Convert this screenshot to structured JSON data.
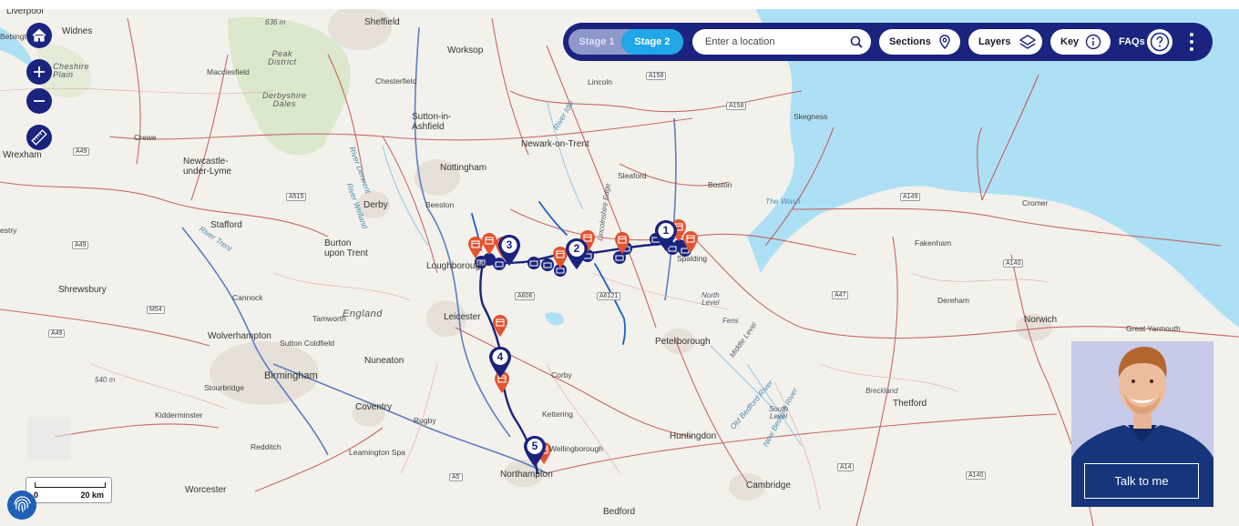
{
  "toolbar": {
    "stage1_label": "Stage 1",
    "stage2_label": "Stage 2",
    "active_stage": "Stage 2",
    "search_placeholder": "Enter a location",
    "sections_label": "Sections",
    "layers_label": "Layers",
    "key_label": "Key",
    "faqs_label": "FAQs",
    "colors": {
      "bar": "#1a237e",
      "active_stage": "#21a6e8"
    }
  },
  "controls": {
    "icons": [
      "home-icon",
      "zoom-in-icon",
      "zoom-out-icon",
      "ruler-icon",
      "fingerprint-icon"
    ]
  },
  "scale": {
    "zero": "0",
    "distance": "20 km"
  },
  "assistant": {
    "button_label": "Talk to me"
  },
  "route": {
    "color": "#1a237e",
    "markers": [
      "1",
      "2",
      "3",
      "4",
      "5"
    ],
    "event_marker_color": "#e4522f",
    "camera_marker_color": "#1a237e"
  },
  "map": {
    "places": {
      "liverpool": "Liverpool",
      "widnes": "Widnes",
      "bebington": "Bebington",
      "sheffield": "Sheffield",
      "height636": "636 m",
      "peak_district": "Peak\nDistrict",
      "cheshire_plain": "Cheshire\nPlain",
      "macclesfield": "Macclesfield",
      "worksop": "Worksop",
      "chesterfield": "Chesterfield",
      "derbyshire_dales": "Derbyshire\nDales",
      "lincoln": "Lincoln",
      "sutton_ashfield": "Sutton-in-\nAshfield",
      "crewe": "Crewe",
      "wrexham": "Wrexham",
      "newark": "Newark-on-Trent",
      "skegness": "Skegness",
      "newcastle": "Newcastle-\nunder-Lyme",
      "sleaford": "Sleaford",
      "nottingham": "Nottingham",
      "beeston": "Beeston",
      "boston": "Boston",
      "the_wash": "The Wash",
      "cromer": "Cromer",
      "derby": "Derby",
      "estry": "estry",
      "stafford": "Stafford",
      "burton": "Burton\nupon Trent",
      "loughborough": "Loughborough",
      "spalding": "Spalding",
      "fakenham": "Fakenham",
      "shrewsbury": "Shrewsbury",
      "cannock": "Cannock",
      "north_level": "North\nLevel",
      "dereham": "Dereham",
      "england": "England",
      "tamworth": "Tamworth",
      "leicester": "Leicester",
      "fens": "Fens",
      "norwich": "Norwich",
      "great_yarmouth": "Great Yarmouth",
      "wolverhampton": "Wolverhampton",
      "sutton_coldfield": "Sutton Coldfield",
      "peterborough": "Peterborough",
      "middle_level": "Middle Level",
      "nuneaton": "Nuneaton",
      "corby": "Corby",
      "birmingham": "Birmingham",
      "height540": "540 m",
      "stourbridge": "Stourbridge",
      "breckland": "Breckland",
      "thetford": "Thetford",
      "coventry": "Coventry",
      "kidderminster": "Kidderminster",
      "rugby": "Rugby",
      "kettering": "Kettering",
      "south_level": "South\nLevel",
      "huntingdon": "Huntingdon",
      "redditch": "Redditch",
      "leamington": "Leamington Spa",
      "wellingborough": "Wellingborough",
      "northampton": "Northampton",
      "worcester": "Worcester",
      "cambridge": "Cambridge",
      "bedford": "Bedford",
      "river_idle": "River Idle",
      "river_trent": "River Trent",
      "river_derwent": "River Derwent",
      "river_welland": "River Welland",
      "lincolnshire_edge": "Lincolnshire Edge",
      "old_bedford": "Old Bedford River",
      "new_bedford": "New Bedford River"
    },
    "roads": {
      "a158": "A158",
      "a158b": "A158",
      "a49": "A49",
      "a515": "A515",
      "a149": "A149",
      "a49b": "A49",
      "a606": "A606",
      "a6121": "A6121",
      "a47": "A47",
      "a140": "A140",
      "m54": "M54",
      "a49c": "A49",
      "a5": "A5",
      "a14": "A14",
      "a140b": "A140"
    }
  }
}
